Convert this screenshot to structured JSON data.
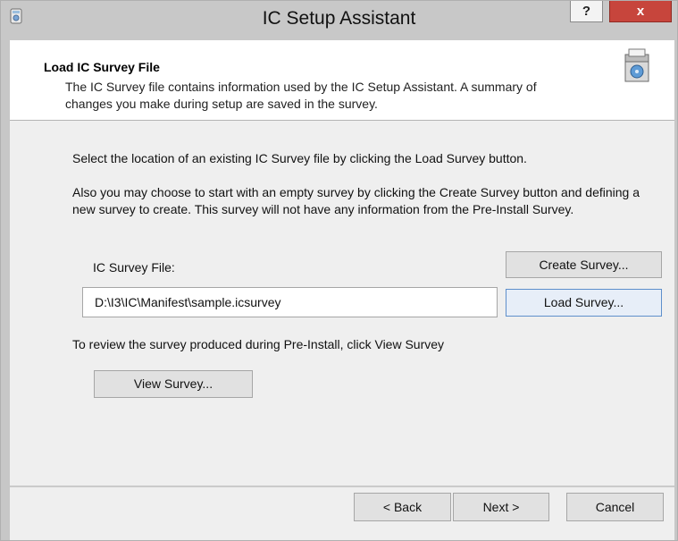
{
  "window": {
    "title": "IC Setup Assistant",
    "help_label": "?",
    "close_label": "x"
  },
  "header": {
    "title": "Load IC Survey File",
    "description": "The IC Survey file contains information used by the IC Setup Assistant. A summary of changes you make during setup are saved in the survey."
  },
  "content": {
    "select_text": "Select the location of an existing IC Survey file by clicking the Load Survey button.",
    "create_text": "Also you may choose to start with an empty survey by clicking the Create Survey button and defining a new survey to create. This survey will not have any information from the Pre-Install Survey.",
    "file_label": "IC Survey File:",
    "file_value": "D:\\I3\\IC\\Manifest\\sample.icsurvey",
    "create_button": "Create Survey...",
    "load_button": "Load Survey...",
    "review_text": "To review the survey produced during Pre-Install, click View Survey",
    "view_button": "View Survey..."
  },
  "footer": {
    "back_button": "< Back",
    "next_button": "Next >",
    "cancel_button": "Cancel"
  },
  "icons": {
    "app": "setup-assistant-icon",
    "header": "installer-box-icon",
    "help": "help-icon",
    "close": "close-icon"
  }
}
